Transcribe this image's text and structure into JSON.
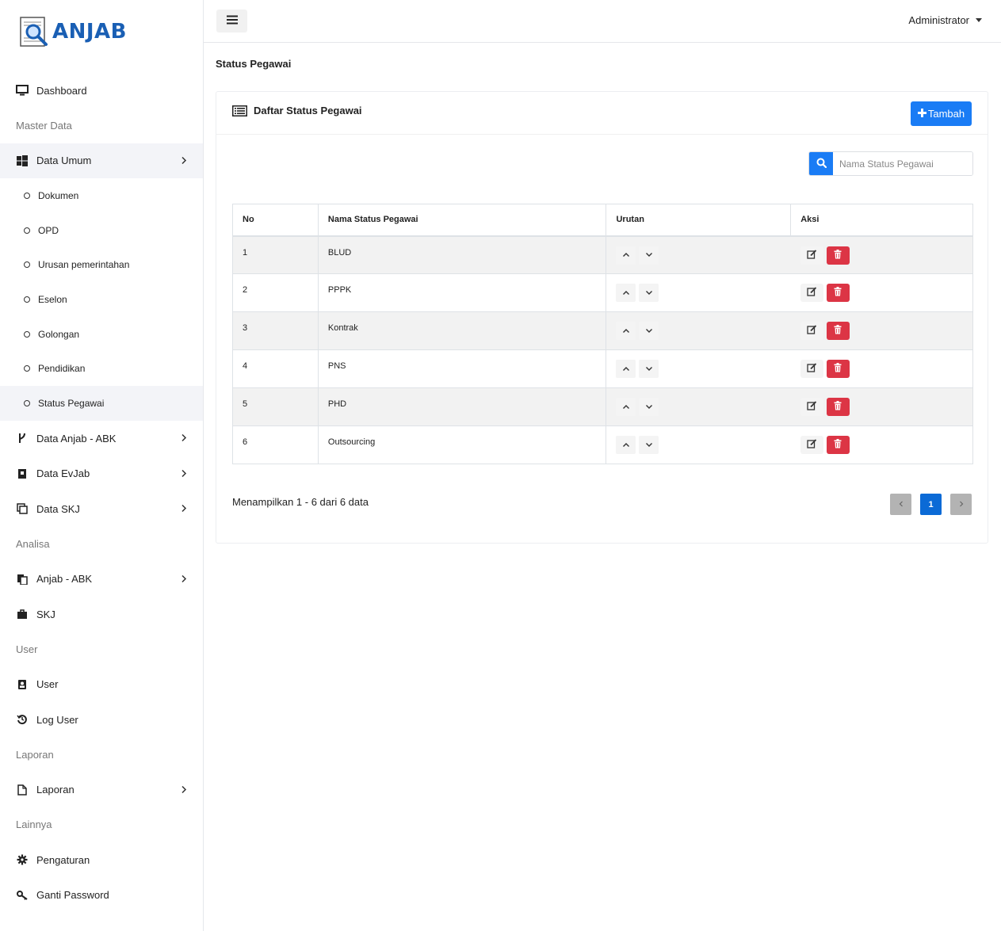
{
  "brand": {
    "name": "ANJAB"
  },
  "sidebar": {
    "dashboard": "Dashboard",
    "master_header": "Master Data",
    "data_umum": "Data Umum",
    "sub": [
      "Dokumen",
      "OPD",
      "Urusan pemerintahan",
      "Eselon",
      "Golongan",
      "Pendidikan",
      "Status Pegawai"
    ],
    "data_anjab": "Data Anjab - ABK",
    "data_evjab": "Data EvJab",
    "data_skj": "Data SKJ",
    "analisa_header": "Analisa",
    "anjab_abk": "Anjab - ABK",
    "skj": "SKJ",
    "user_header": "User",
    "user": "User",
    "log_user": "Log User",
    "laporan_header": "Laporan",
    "laporan": "Laporan",
    "lainnya_header": "Lainnya",
    "pengaturan": "Pengaturan",
    "ganti_password": "Ganti Password"
  },
  "topbar": {
    "user": "Administrator"
  },
  "page": {
    "title": "Status Pegawai",
    "card_title": "Daftar Status Pegawai",
    "add_label": "Tambah",
    "search_placeholder": "Nama Status Pegawai"
  },
  "table": {
    "headers": [
      "No",
      "Nama Status Pegawai",
      "Urutan",
      "Aksi"
    ],
    "rows": [
      {
        "no": "1",
        "name": "BLUD"
      },
      {
        "no": "2",
        "name": "PPPK"
      },
      {
        "no": "3",
        "name": "Kontrak"
      },
      {
        "no": "4",
        "name": "PNS"
      },
      {
        "no": "5",
        "name": "PHD"
      },
      {
        "no": "6",
        "name": "Outsourcing"
      }
    ]
  },
  "footer": {
    "info": "Menampilkan 1 - 6 dari 6 data",
    "current_page": "1"
  },
  "colors": {
    "primary": "#1a7cf5",
    "danger": "#dc3545",
    "brand": "#1a5fb4",
    "page_active": "#0b6ad6"
  }
}
